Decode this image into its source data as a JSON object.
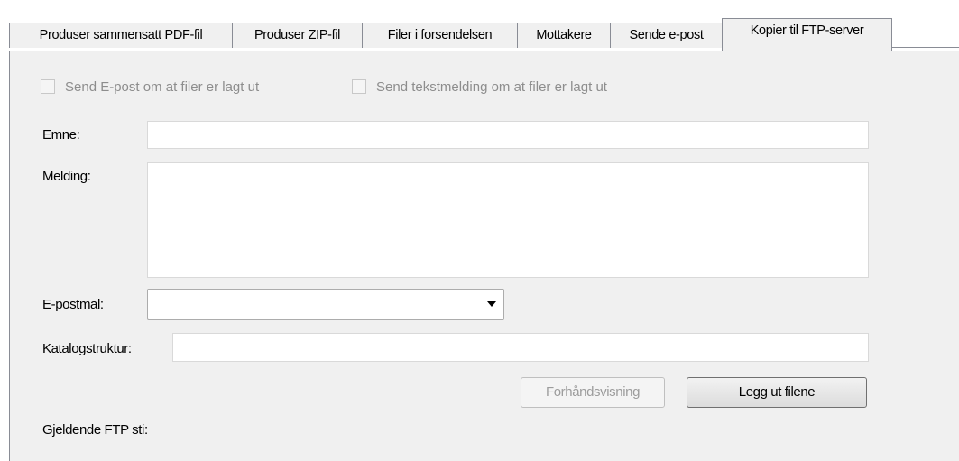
{
  "tabs": [
    {
      "label": "Produser sammensatt PDF-fil"
    },
    {
      "label": "Produser ZIP-fil"
    },
    {
      "label": "Filer i forsendelsen"
    },
    {
      "label": "Mottakere"
    },
    {
      "label": "Sende e-post"
    },
    {
      "label": "Kopier til FTP-server"
    }
  ],
  "active_tab": "Kopier til FTP-server",
  "checkboxes": {
    "send_email": {
      "label": "Send E-post om at filer er lagt ut",
      "checked": false,
      "enabled": false
    },
    "send_sms": {
      "label": "Send tekstmelding om at filer er lagt ut",
      "checked": false,
      "enabled": false
    }
  },
  "form": {
    "subject_label": "Emne:",
    "subject_value": "",
    "message_label": "Melding:",
    "message_value": "",
    "template_label": "E-postmal:",
    "template_value": "",
    "directory_label": "Katalogstruktur:",
    "directory_value": ""
  },
  "buttons": {
    "preview": "Forhåndsvisning",
    "publish": "Legg ut filene"
  },
  "ftp_path_label": "Gjeldende FTP sti:"
}
